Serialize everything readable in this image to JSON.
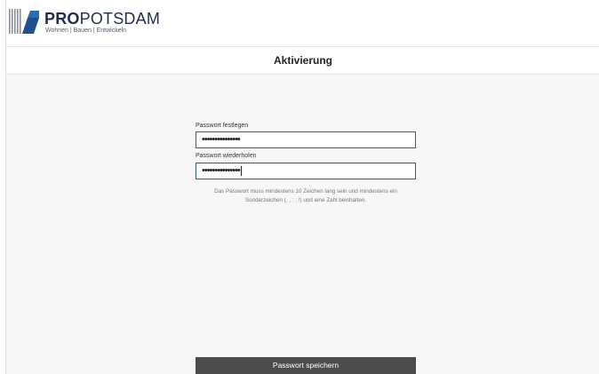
{
  "header": {
    "brand_bold": "PRO",
    "brand_rest": "POTSDAM",
    "tagline": "Wohnen | Bauen | Entwickeln",
    "logo_icon": "propotsdam-logo-icon"
  },
  "page": {
    "title": "Aktivierung"
  },
  "form": {
    "password": {
      "label": "Passwort festlegen",
      "value": "•••••••••••••••"
    },
    "password_repeat": {
      "label": "Passwort wiederholen",
      "value": "•••••••••••••••"
    },
    "hint": "Das Passwort muss mindestens 10 Zeichen lang sein und mindestens ein Sonderzeichen (. , : ; !) und eine Zahl beinhalten.",
    "submit_label": "Passwort speichern"
  },
  "colors": {
    "brand": "#1f2d4e",
    "accent_blue": "#1d5f8a",
    "button_bg": "#4c4c4c",
    "page_bg": "#f7f7f7"
  }
}
